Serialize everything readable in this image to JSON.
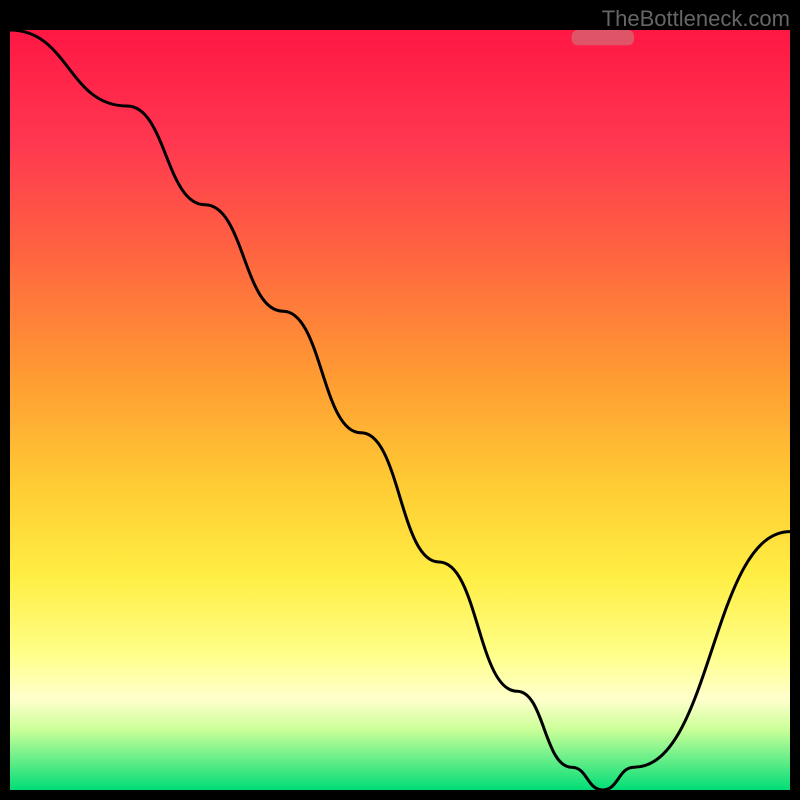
{
  "watermark": "TheBottleneck.com",
  "chart_data": {
    "type": "line",
    "title": "",
    "xlabel": "",
    "ylabel": "",
    "xlim": [
      0,
      100
    ],
    "ylim": [
      0,
      100
    ],
    "series": [
      {
        "name": "curve",
        "x": [
          0,
          15,
          25,
          35,
          45,
          55,
          65,
          72,
          76,
          80,
          100
        ],
        "y": [
          100,
          90,
          77,
          63,
          47,
          30,
          13,
          3,
          0,
          3,
          34
        ]
      }
    ],
    "gradient_stops": [
      {
        "offset": 0,
        "color": "#ff1744"
      },
      {
        "offset": 15,
        "color": "#ff3850"
      },
      {
        "offset": 30,
        "color": "#ff6640"
      },
      {
        "offset": 45,
        "color": "#ff9933"
      },
      {
        "offset": 60,
        "color": "#ffcc33"
      },
      {
        "offset": 72,
        "color": "#ffee44"
      },
      {
        "offset": 82,
        "color": "#ffff88"
      },
      {
        "offset": 88,
        "color": "#ffffcc"
      },
      {
        "offset": 92,
        "color": "#ccff99"
      },
      {
        "offset": 96,
        "color": "#66ee88"
      },
      {
        "offset": 100,
        "color": "#00dd77"
      }
    ],
    "marker": {
      "x": 76,
      "y": 99,
      "width": 8,
      "height": 2,
      "color": "#dd5566"
    }
  }
}
